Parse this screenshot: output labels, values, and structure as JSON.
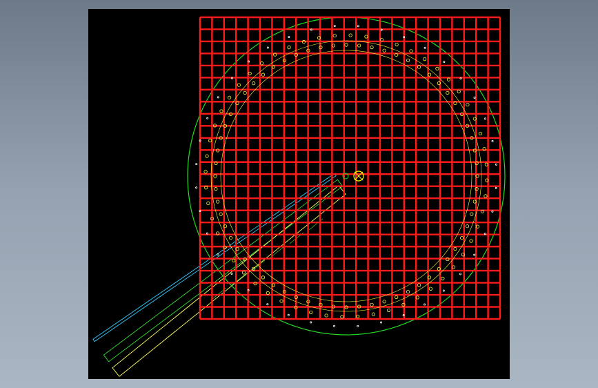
{
  "viewer": {
    "background_gradient": [
      "#6c7a89",
      "#aab6c3"
    ],
    "canvas_color": "#000000"
  },
  "drawing": {
    "layers": {
      "grid": "#ff1a1a",
      "circle": "#22dd22",
      "bolt_ring": "#ffff44",
      "small_points": "#ffffff",
      "pipe_cyan": "#33ccff",
      "pipe_green": "#33dd33",
      "pipe_yellow": "#ffff66",
      "center_mark": "#ffff00"
    },
    "grid": {
      "columns": 25,
      "rows": 25
    },
    "rings": {
      "outer_holes": 56,
      "inner_holes": 64
    }
  }
}
